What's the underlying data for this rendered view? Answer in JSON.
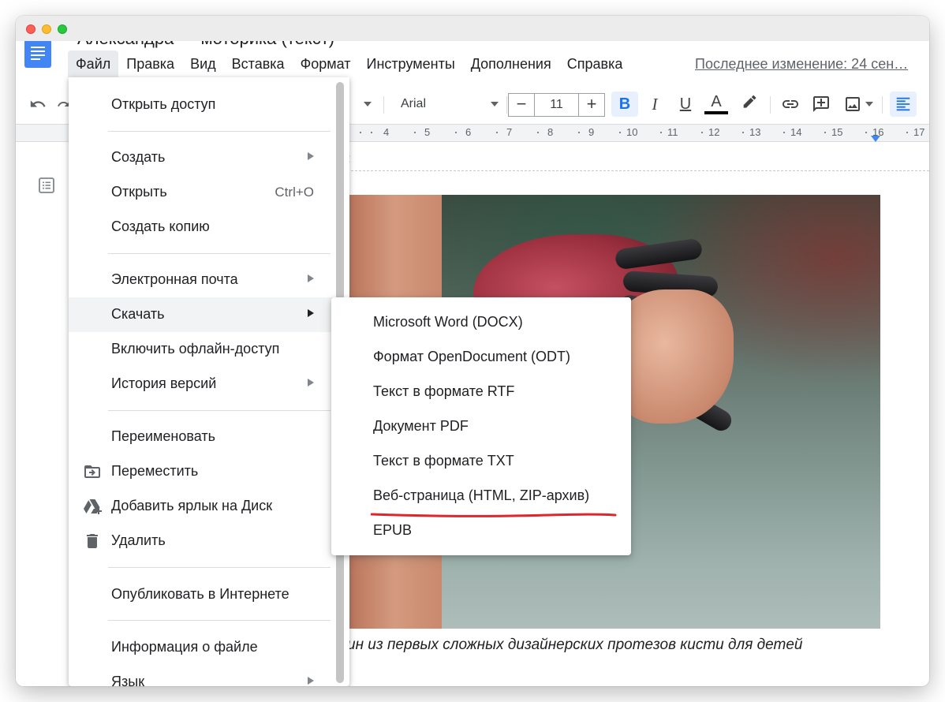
{
  "document": {
    "title": "Александра — моторика (текст)",
    "last_edit": "Последнее изменение: 24 сен…"
  },
  "menubar": {
    "items": [
      "Файл",
      "Правка",
      "Вид",
      "Вставка",
      "Формат",
      "Инструменты",
      "Дополнения",
      "Справка"
    ],
    "active": "Файл"
  },
  "toolbar": {
    "font": "Arial",
    "font_size": "11",
    "minus": "−",
    "plus": "+",
    "bold": "B",
    "italic": "I",
    "underline": "U",
    "text_color": "A",
    "text_color_value": "#000000"
  },
  "ruler": {
    "numbers": [
      "4",
      "5",
      "6",
      "7",
      "8",
      "9",
      "10",
      "11",
      "12",
      "13",
      "14",
      "15",
      "16",
      "17"
    ]
  },
  "file_menu": {
    "items": [
      {
        "label": "Открыть доступ"
      },
      {
        "label": "Создать",
        "submenu": true
      },
      {
        "label": "Открыть",
        "shortcut": "Ctrl+O"
      },
      {
        "label": "Создать копию"
      },
      {
        "label": "Электронная почта",
        "submenu": true
      },
      {
        "label": "Скачать",
        "submenu": true,
        "highlighted": true
      },
      {
        "label": "Включить офлайн-доступ"
      },
      {
        "label": "История версий",
        "submenu": true
      },
      {
        "label": "Переименовать"
      },
      {
        "label": "Переместить",
        "icon": "folder-move-icon"
      },
      {
        "label": "Добавить ярлык на Диск",
        "icon": "drive-shortcut-icon"
      },
      {
        "label": "Удалить",
        "icon": "trash-icon"
      },
      {
        "label": "Опубликовать в Интернете"
      },
      {
        "label": "Информация о файле"
      },
      {
        "label": "Язык",
        "submenu": true
      }
    ]
  },
  "download_submenu": {
    "items": [
      "Microsoft Word (DOCX)",
      "Формат OpenDocument (ODT)",
      "Текст в формате RTF",
      "Документ PDF",
      "Текст в формате TXT",
      "Веб-страница (HTML, ZIP-архив)",
      "EPUB"
    ],
    "emphasized": "Веб-страница (HTML, ZIP-архив)"
  },
  "content": {
    "header_text": ":",
    "caption": "ин из первых сложных дизайнерских протезов кисти для детей"
  },
  "colors": {
    "accent": "#4285f4",
    "active_bg": "#e8eaed",
    "menu_hover": "#f1f3f4",
    "underline_mark": "#e0262b"
  }
}
